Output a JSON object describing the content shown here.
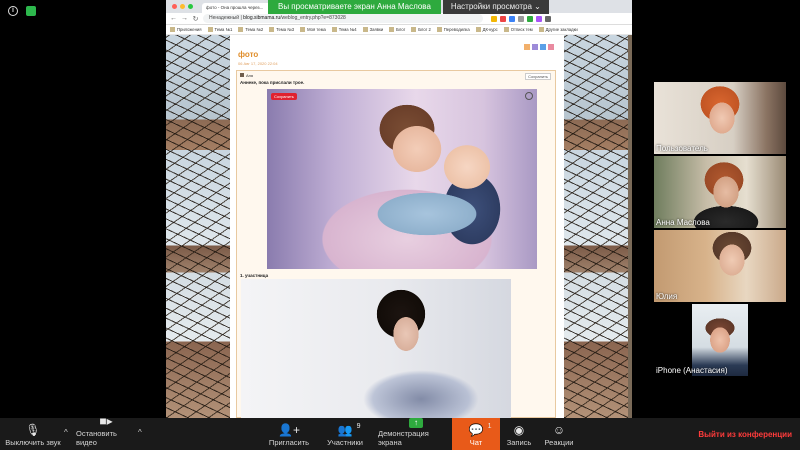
{
  "share_banner": {
    "text": "Вы просматриваете экран Анна Маслова",
    "options": "Настройки просмотра ⌄"
  },
  "browser": {
    "tab_title": "фото - Она прошла через...",
    "url_prefix": "Ненадежный | ",
    "url_host": "blog.sibmama.ru",
    "url_path": "/weblog_entry.php?e=873028",
    "bookmarks": [
      "Приложения",
      "Тема №1",
      "Тема №2",
      "Тема №3",
      "Моя тема",
      "Тема №4",
      "Заявки",
      "Блог",
      "Блог 2",
      "Переводилка",
      "ДК-курс",
      "Отписк тем",
      "Другие закладки"
    ]
  },
  "post": {
    "title": "фото",
    "date": "06 Авг 17, 2020 22:04",
    "author": "Аня",
    "tag": "Сохранить",
    "text": "Аннеке, пока прислали трое.",
    "save_label": "Сохранить",
    "caption": "1. участница"
  },
  "participants": [
    {
      "name": "Пользователь"
    },
    {
      "name": "Анна Маслова"
    },
    {
      "name": "Юлия"
    },
    {
      "name": "iPhone (Анастасия)"
    }
  ],
  "toolbar": {
    "mute": "Выключить звук",
    "stop_video": "Остановить видео",
    "invite": "Пригласить",
    "participants": "Участники",
    "participants_count": "9",
    "share": "Демонстрация экрана",
    "chat": "Чат",
    "chat_count": "1",
    "record": "Запись",
    "reactions": "Реакции",
    "leave": "Выйти из конференции"
  },
  "colors": {
    "share_green": "#2eaa3e",
    "chat_orange": "#e85a19",
    "leave_red": "#ff3b3b",
    "post_title": "#e08e2b"
  }
}
